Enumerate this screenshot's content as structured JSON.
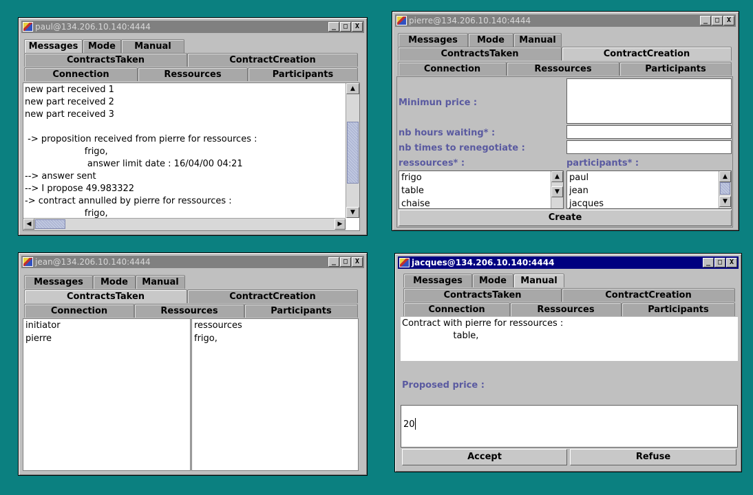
{
  "tabs": {
    "messages": "Messages",
    "mode": "Mode",
    "manual": "Manual",
    "contracts_taken": "ContractsTaken",
    "contract_creation": "ContractCreation",
    "connection": "Connection",
    "ressources": "Ressources",
    "participants": "Participants"
  },
  "window_buttons": {
    "minimize": "_",
    "maximize": "□",
    "close": "X"
  },
  "paul": {
    "title": "paul@134.206.10.140:4444",
    "lines": [
      "new part received 1",
      "new part received 2",
      "new part received 3",
      "",
      " -> proposition received from pierre for ressources :",
      "                     frigo,",
      "                      answer limit date : 16/04/00 04:21",
      "--> answer sent",
      "--> I propose 49.983322",
      "-> contract annulled by pierre for ressources :",
      "                     frigo,"
    ]
  },
  "pierre": {
    "title": "pierre@134.206.10.140:4444",
    "min_price_label": "Minimun price :",
    "hours_label": "nb hours waiting* :",
    "renegotiate_label": "nb times to renegotiate :",
    "ressources_label": "ressources* :",
    "participants_label": "participants* :",
    "ressources": [
      "frigo",
      "table",
      "chaise"
    ],
    "participants": [
      "paul",
      "jean",
      "jacques"
    ],
    "create_label": "Create"
  },
  "jean": {
    "title": "jean@134.206.10.140:4444",
    "col1": [
      "initiator",
      "pierre"
    ],
    "col2": [
      "ressources",
      "frigo,"
    ]
  },
  "jacques": {
    "title": "jacques@134.206.10.140:4444",
    "message_lines": [
      "Contract with pierre for ressources :",
      "                  table,"
    ],
    "proposed_price_label": "Proposed price :",
    "price_value": "20",
    "accept_label": "Accept",
    "refuse_label": "Refuse"
  }
}
